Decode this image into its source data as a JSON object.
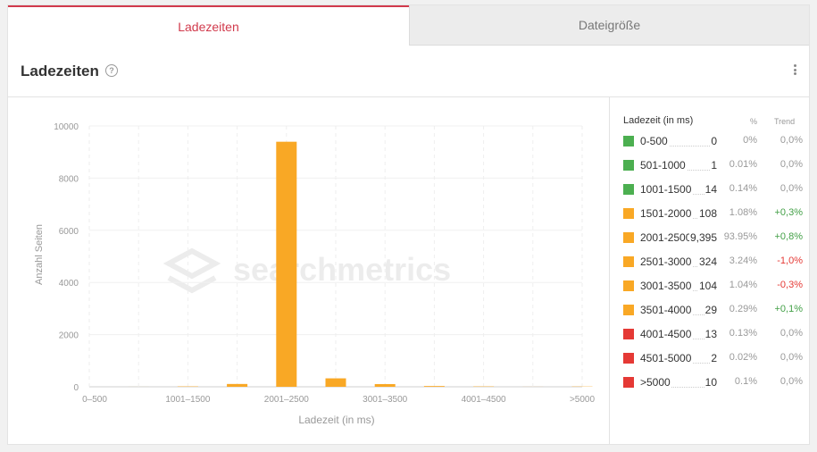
{
  "tabs": [
    {
      "label": "Ladezeiten",
      "active": true
    },
    {
      "label": "Dateigröße",
      "active": false
    }
  ],
  "header": {
    "title": "Ladezeiten",
    "help_symbol": "?"
  },
  "watermark": "searchmetrics",
  "legend": {
    "heading": "Ladezeit (in ms)",
    "col_percent": "%",
    "col_trend": "Trend",
    "rows": [
      {
        "range": "0-500",
        "count": "0",
        "percent": "0%",
        "trend": "0,0%",
        "color": "#4caf50",
        "trend_color": "#999999"
      },
      {
        "range": "501-1000",
        "count": "1",
        "percent": "0.01%",
        "trend": "0,0%",
        "color": "#4caf50",
        "trend_color": "#999999"
      },
      {
        "range": "1001-1500",
        "count": "14",
        "percent": "0.14%",
        "trend": "0,0%",
        "color": "#4caf50",
        "trend_color": "#999999"
      },
      {
        "range": "1501-2000",
        "count": "108",
        "percent": "1.08%",
        "trend": "+0,3%",
        "color": "#f9a825",
        "trend_color": "#43a047"
      },
      {
        "range": "2001-2500",
        "count": "9,395",
        "percent": "93.95%",
        "trend": "+0,8%",
        "color": "#f9a825",
        "trend_color": "#43a047"
      },
      {
        "range": "2501-3000",
        "count": "324",
        "percent": "3.24%",
        "trend": "-1,0%",
        "color": "#f9a825",
        "trend_color": "#e53935"
      },
      {
        "range": "3001-3500",
        "count": "104",
        "percent": "1.04%",
        "trend": "-0,3%",
        "color": "#f9a825",
        "trend_color": "#e53935"
      },
      {
        "range": "3501-4000",
        "count": "29",
        "percent": "0.29%",
        "trend": "+0,1%",
        "color": "#f9a825",
        "trend_color": "#43a047"
      },
      {
        "range": "4001-4500",
        "count": "13",
        "percent": "0.13%",
        "trend": "0,0%",
        "color": "#e53935",
        "trend_color": "#999999"
      },
      {
        "range": "4501-5000",
        "count": "2",
        "percent": "0.02%",
        "trend": "0,0%",
        "color": "#e53935",
        "trend_color": "#999999"
      },
      {
        "range": ">5000",
        "count": "10",
        "percent": "0.1%",
        "trend": "0,0%",
        "color": "#e53935",
        "trend_color": "#999999"
      }
    ]
  },
  "chart_data": {
    "type": "bar",
    "categories": [
      "0-500",
      "501-1000",
      "1001-1500",
      "1501-2000",
      "2001-2500",
      "2501-3000",
      "3001-3500",
      "3501-4000",
      "4001-4500",
      "4501-5000",
      ">5000"
    ],
    "tick_labels": [
      "0–500",
      "",
      "1001–1500",
      "",
      "2001–2500",
      "",
      "3001–3500",
      "",
      "4001–4500",
      "",
      ">5000"
    ],
    "values": [
      0,
      1,
      14,
      108,
      9395,
      324,
      104,
      29,
      13,
      2,
      10
    ],
    "bar_color": "#f9a825",
    "xlabel": "Ladezeit (in ms)",
    "ylabel": "Anzahl Seiten",
    "ylim": [
      0,
      10000
    ],
    "yticks": [
      0,
      2000,
      4000,
      6000,
      8000,
      10000
    ],
    "grid": true
  }
}
